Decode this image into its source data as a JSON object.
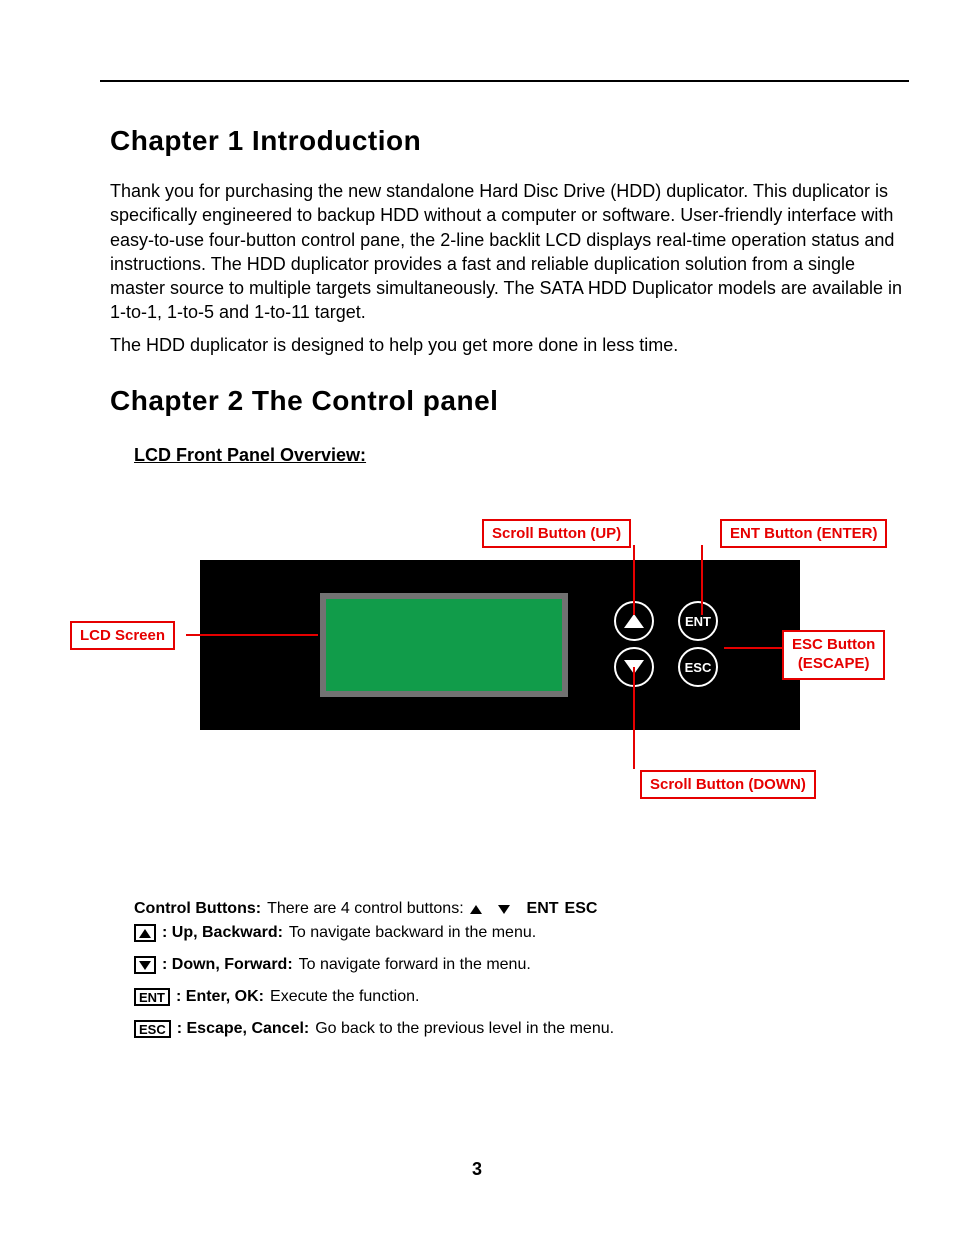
{
  "chapter1": {
    "title": "Chapter 1  Introduction",
    "p1": "Thank you for purchasing the new standalone Hard Disc Drive (HDD) duplicator. This duplicator is specifically engineered to backup HDD without a computer or software. User-friendly interface with easy-to-use four-button control pane, the 2-line backlit LCD displays real-time operation status and instructions. The HDD duplicator provides a fast and reliable duplication solution from a single master source to multiple targets simultaneously. The SATA HDD Duplicator models are available in 1-to-1, 1-to-5 and 1-to-11 target.",
    "p2": "The HDD duplicator is designed to help you get more done in less time."
  },
  "chapter2": {
    "title": "Chapter 2  The Control panel",
    "subheading": "LCD Front Panel Overview:"
  },
  "panel": {
    "ent": "ENT",
    "esc": "ESC",
    "callouts": {
      "lcd": "LCD Screen",
      "up": "Scroll Button (UP)",
      "ent": "ENT Button (ENTER)",
      "esc_line1": "ESC Button",
      "esc_line2": "(ESCAPE)",
      "down": "Scroll Button (DOWN)"
    }
  },
  "legend": {
    "intro_bold": "Control Buttons:",
    "intro_text": " There are 4 control buttons: ",
    "intro_suffix_ent": "ENT",
    "intro_suffix_esc": "ESC",
    "rows": [
      {
        "label": ":  Up, Backward:",
        "desc": " To navigate backward in the menu."
      },
      {
        "label": " :  Down, Forward:",
        "desc": " To navigate forward in the menu."
      },
      {
        "box": "ENT",
        "label": " : Enter, OK:",
        "desc": " Execute the function."
      },
      {
        "box": "ESC",
        "label": " : Escape, Cancel:",
        "desc": " Go back to the previous level in the menu."
      }
    ]
  },
  "page": "3"
}
